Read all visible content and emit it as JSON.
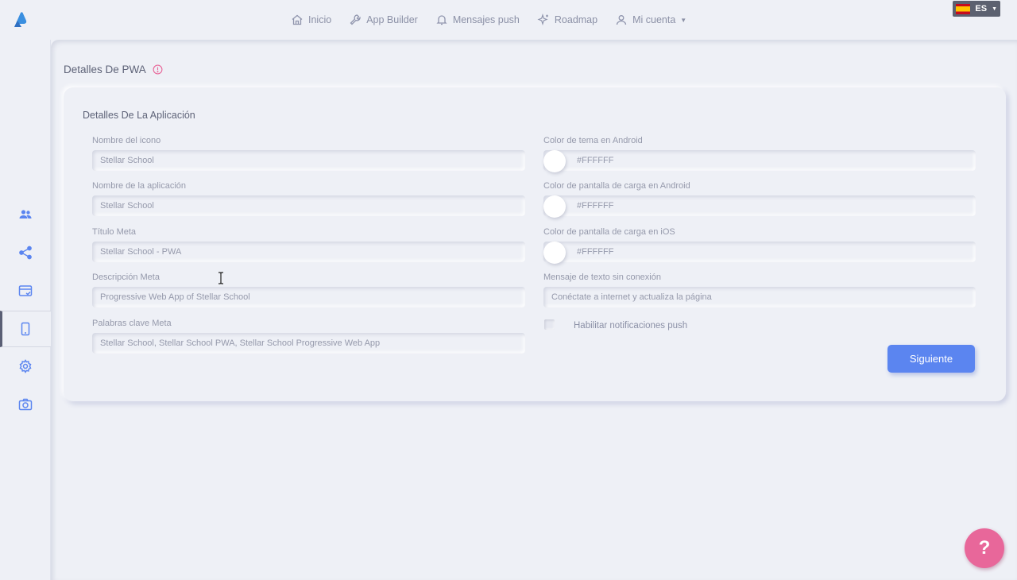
{
  "nav": {
    "items": [
      {
        "label": "Inicio",
        "icon": "home-icon"
      },
      {
        "label": "App Builder",
        "icon": "wrench-icon"
      },
      {
        "label": "Mensajes push",
        "icon": "bell-icon"
      },
      {
        "label": "Roadmap",
        "icon": "sparkle-icon"
      },
      {
        "label": "Mi cuenta",
        "icon": "user-icon"
      }
    ],
    "language": "ES"
  },
  "sidebar": {
    "items": [
      {
        "icon": "users-icon"
      },
      {
        "icon": "share-icon"
      },
      {
        "icon": "card-icon"
      },
      {
        "icon": "phone-icon",
        "active": true
      },
      {
        "icon": "gear-icon"
      },
      {
        "icon": "camera-icon"
      }
    ]
  },
  "page": {
    "title": "Detalles De PWA"
  },
  "card": {
    "title": "Detalles De La Aplicación",
    "left": [
      {
        "label": "Nombre del icono",
        "value": "Stellar School"
      },
      {
        "label": "Nombre de la aplicación",
        "value": "Stellar School"
      },
      {
        "label": "Título Meta",
        "value": "Stellar School - PWA"
      },
      {
        "label": "Descripción Meta",
        "value": "Progressive Web App of Stellar School"
      },
      {
        "label": "Palabras clave Meta",
        "value": "Stellar School, Stellar School PWA, Stellar School Progressive Web App"
      }
    ],
    "right": [
      {
        "label": "Color de tema en Android",
        "value": "#FFFFFF"
      },
      {
        "label": "Color de pantalla de carga en Android",
        "value": "#FFFFFF"
      },
      {
        "label": "Color de pantalla de carga en iOS",
        "value": "#FFFFFF"
      },
      {
        "label": "Mensaje de texto sin conexión",
        "value": "Conéctate a internet y actualiza la página"
      }
    ],
    "push_checkbox_label": "Habilitar notificaciones push",
    "next_button": "Siguiente"
  },
  "help_button": "?",
  "colors": {
    "accent": "#5b85f0",
    "help": "#e8679a",
    "background": "#eef0f6"
  }
}
